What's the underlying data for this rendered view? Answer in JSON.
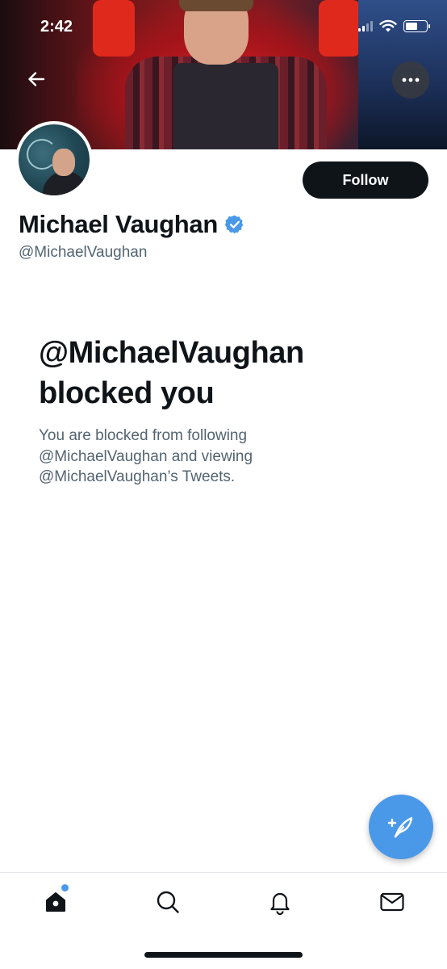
{
  "status_bar": {
    "time": "2:42",
    "icons": [
      "cellular-signal-icon",
      "wifi-icon",
      "battery-icon"
    ]
  },
  "header": {
    "back_icon": "arrow-left-icon",
    "more_icon": "more-horizontal-icon"
  },
  "profile": {
    "display_name": "Michael Vaughan",
    "handle": "@MichaelVaughan",
    "verified": true,
    "follow_label": "Follow"
  },
  "blocked": {
    "title_line1": "@MichaelVaughan",
    "title_line2": "blocked you",
    "body_line1": "You are blocked from following",
    "body_line2": "@MichaelVaughan and viewing",
    "body_line3": "@MichaelVaughan’s Tweets."
  },
  "fab": {
    "icon": "compose-tweet-icon"
  },
  "tabbar": {
    "items": [
      "home-icon",
      "search-icon",
      "notifications-icon",
      "messages-icon"
    ],
    "active": "home-icon",
    "home_has_new": true
  },
  "colors": {
    "accent": "#4a99e9",
    "text_primary": "#0f1419",
    "text_secondary": "#536471",
    "follow_bg": "#0f1419"
  }
}
